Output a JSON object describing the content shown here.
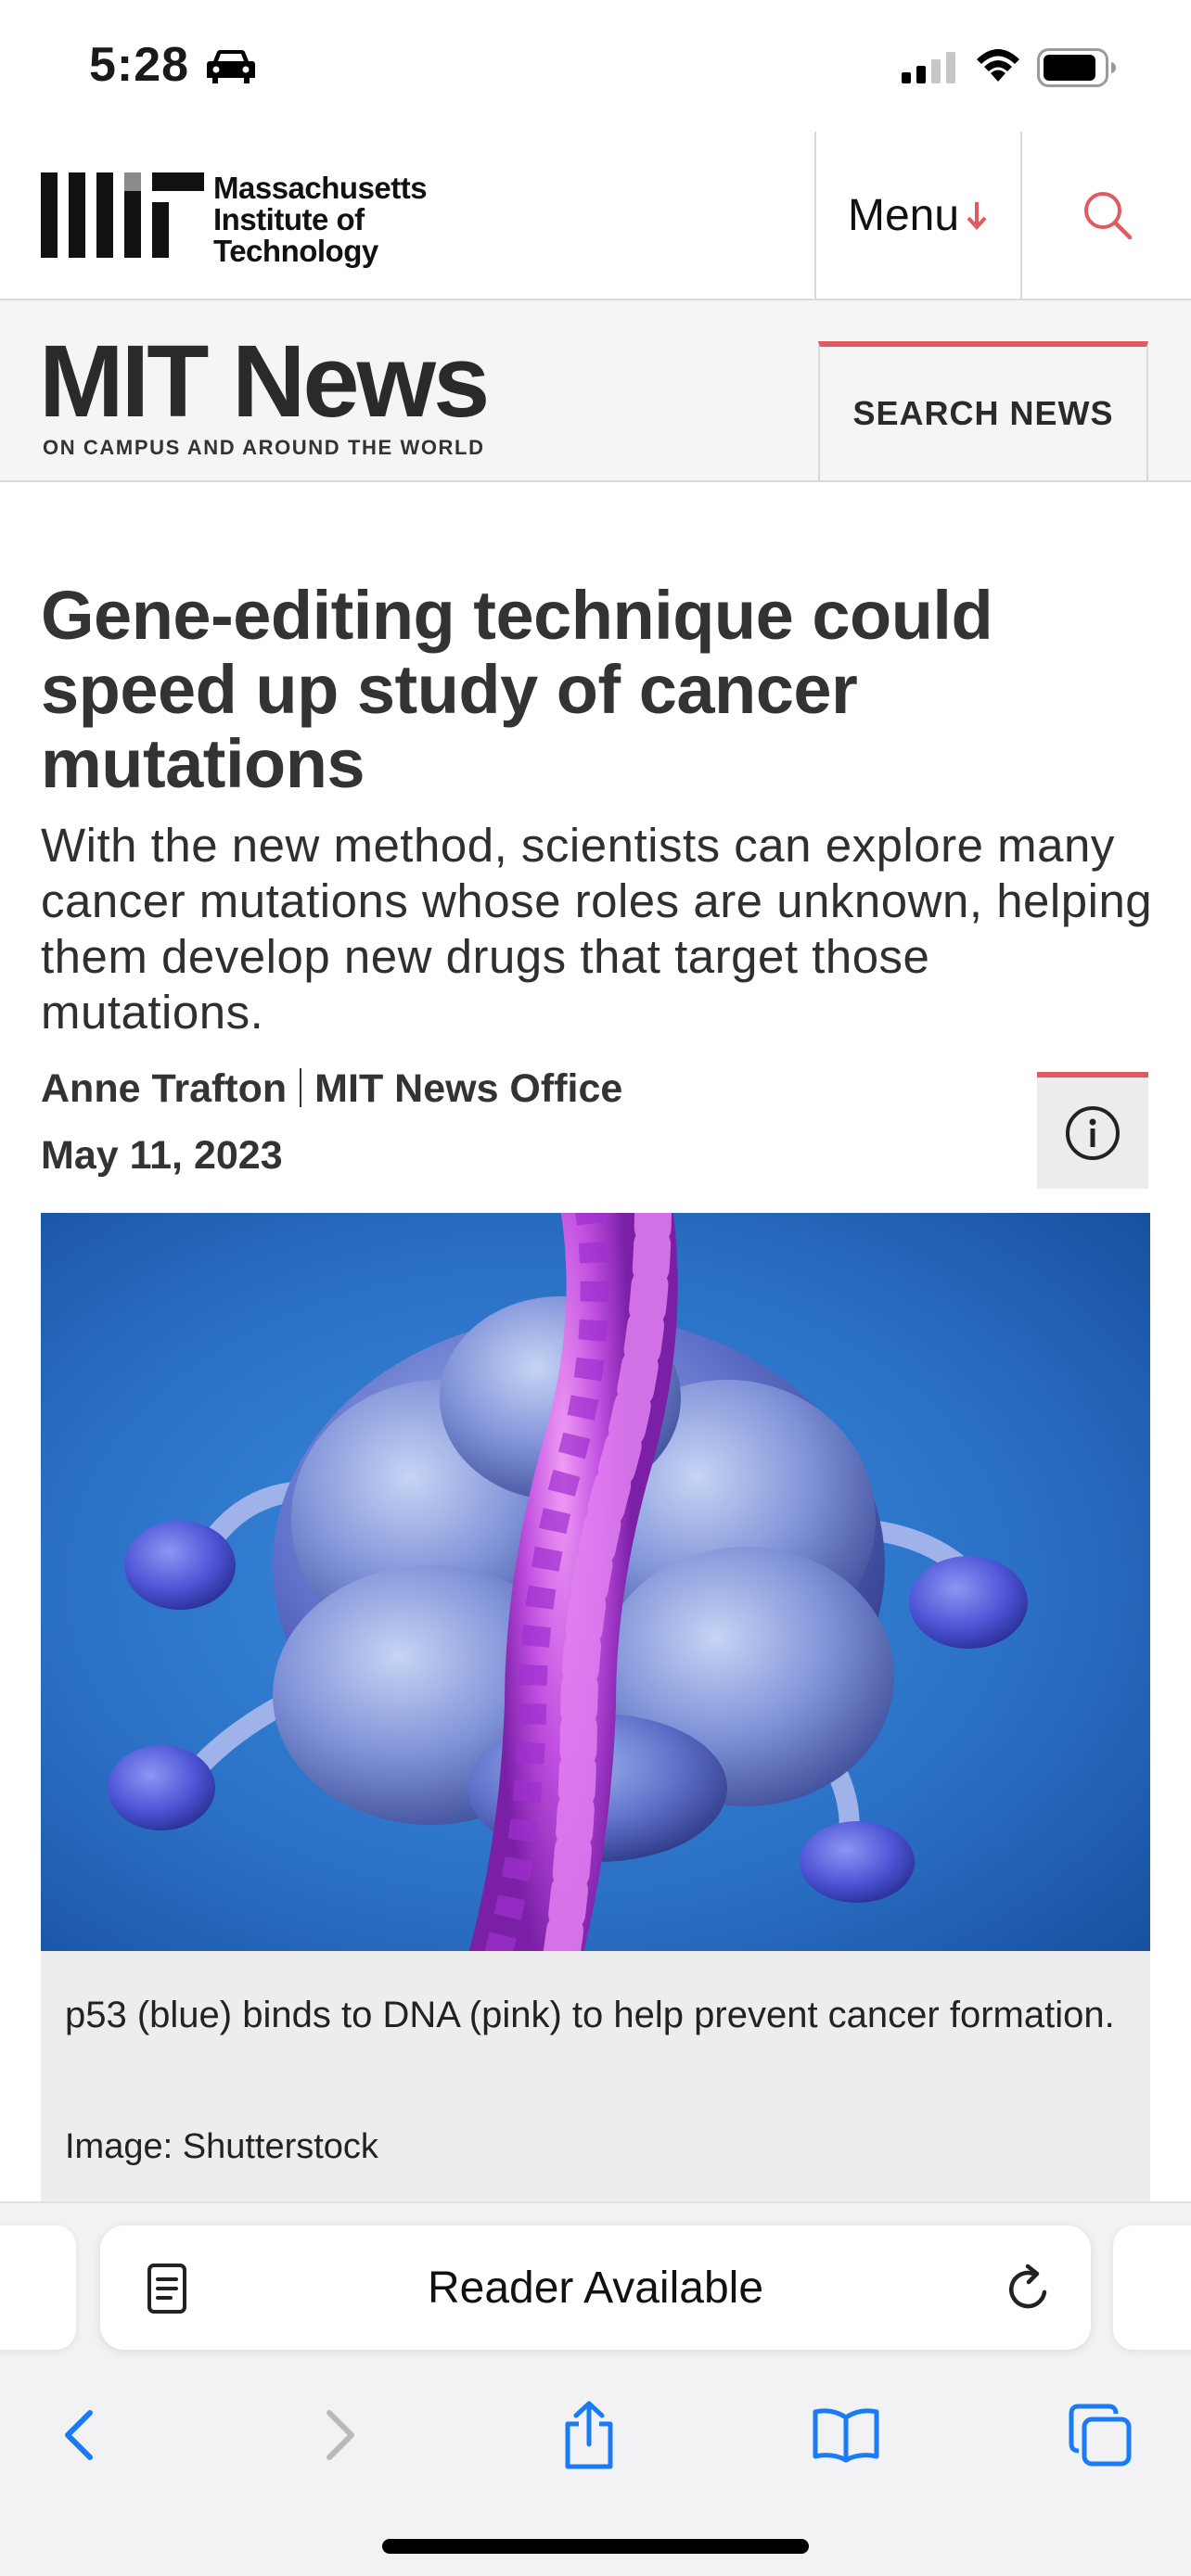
{
  "status_bar": {
    "time": "5:28",
    "icons": [
      "car-icon",
      "cellular-signal-icon",
      "wifi-icon",
      "battery-icon"
    ]
  },
  "header": {
    "logo": "MIT",
    "wordmark": [
      "Massachusetts",
      "Institute of",
      "Technology"
    ],
    "menu_label": "Menu",
    "menu_arrow_icon": "arrow-down-icon",
    "search_icon": "search-icon"
  },
  "news_bar": {
    "title": "MIT News",
    "tagline": "ON CAMPUS AND AROUND THE WORLD",
    "search_button": "SEARCH NEWS"
  },
  "article": {
    "headline": "Gene-editing technique could speed up study of cancer mutations",
    "dek": "With the new method, scientists can explore many cancer mutations whose roles are unknown, helping them develop new drugs that target those mutations.",
    "author": "Anne Trafton",
    "office": "MIT News Office",
    "date": "May 11, 2023",
    "info_icon": "info-icon",
    "image": {
      "caption": "p53 (blue) binds to DNA (pink) to help prevent cancer formation.",
      "credit": "Image: Shutterstock"
    }
  },
  "safari": {
    "address_text": "Reader Available",
    "reader_icon": "reader-icon",
    "reload_icon": "reload-icon",
    "toolbar": [
      "back-icon",
      "forward-icon",
      "share-icon",
      "bookmarks-icon",
      "tabs-icon"
    ]
  },
  "colors": {
    "accent_red": "#e05a5f",
    "safari_blue": "#1a7cf5",
    "hero_blue": "#2a6fc4",
    "dna_pink": "#b040d8"
  }
}
